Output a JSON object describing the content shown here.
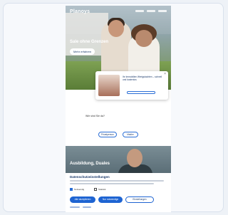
{
  "hero": {
    "logo": "Planoys",
    "headline": "Sale ohne Grenzen",
    "cta": "Mehr erfahren"
  },
  "popup": {
    "text": "Ihr Immobilien Wertgutachten – schnell und kostenlos",
    "close": "×"
  },
  "middle": {
    "prompt": "Wie sind Sie da?",
    "options": [
      "Privatperson",
      "Makler"
    ]
  },
  "banner": {
    "title": "Ausbildung, Duales"
  },
  "form": {
    "title": "Datenschutzeinstellungen",
    "checkboxes": [
      {
        "label": "Notwendig",
        "checked": true
      },
      {
        "label": "Statistik",
        "checked": false
      }
    ],
    "buttons": [
      "Alle akzeptieren",
      "Nur notwendige",
      "Einstellungen"
    ]
  },
  "colors": {
    "accent": "#1e64d2",
    "brand": "#1b3a6b"
  }
}
